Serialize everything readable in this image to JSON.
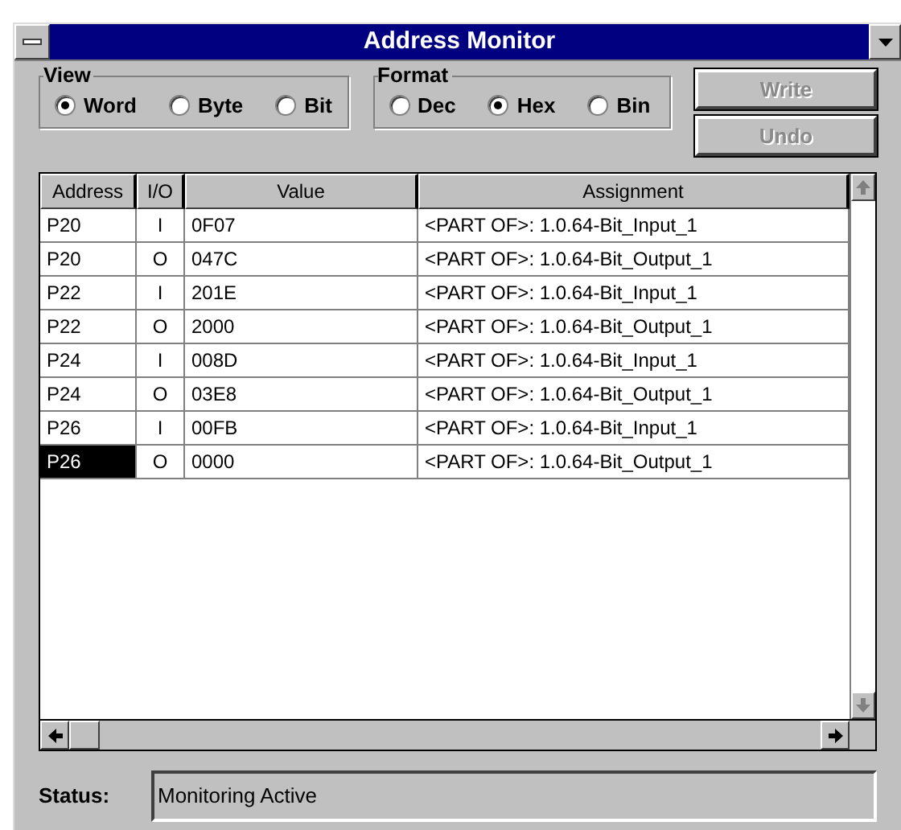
{
  "window": {
    "title": "Address Monitor"
  },
  "view": {
    "label": "View",
    "options": [
      {
        "label": "Word",
        "selected": true
      },
      {
        "label": "Byte",
        "selected": false
      },
      {
        "label": "Bit",
        "selected": false
      }
    ]
  },
  "format": {
    "label": "Format",
    "options": [
      {
        "label": "Dec",
        "selected": false
      },
      {
        "label": "Hex",
        "selected": true
      },
      {
        "label": "Bin",
        "selected": false
      }
    ]
  },
  "buttons": [
    {
      "label": "Write",
      "disabled": true
    },
    {
      "label": "Undo",
      "disabled": true
    }
  ],
  "table": {
    "columns": [
      "Address",
      "I/O",
      "Value",
      "Assignment"
    ],
    "rows": [
      {
        "address": "P20",
        "io": "I",
        "value": "0F07",
        "assignment": "<PART OF>: 1.0.64-Bit_Input_1",
        "selected": false
      },
      {
        "address": "P20",
        "io": "O",
        "value": "047C",
        "assignment": "<PART OF>: 1.0.64-Bit_Output_1",
        "selected": false
      },
      {
        "address": "P22",
        "io": "I",
        "value": "201E",
        "assignment": "<PART OF>: 1.0.64-Bit_Input_1",
        "selected": false
      },
      {
        "address": "P22",
        "io": "O",
        "value": "2000",
        "assignment": "<PART OF>: 1.0.64-Bit_Output_1",
        "selected": false
      },
      {
        "address": "P24",
        "io": "I",
        "value": "008D",
        "assignment": "<PART OF>: 1.0.64-Bit_Input_1",
        "selected": false
      },
      {
        "address": "P24",
        "io": "O",
        "value": "03E8",
        "assignment": "<PART OF>: 1.0.64-Bit_Output_1",
        "selected": false
      },
      {
        "address": "P26",
        "io": "I",
        "value": "00FB",
        "assignment": "<PART OF>: 1.0.64-Bit_Input_1",
        "selected": false
      },
      {
        "address": "P26",
        "io": "O",
        "value": "0000",
        "assignment": "<PART OF>: 1.0.64-Bit_Output_1",
        "selected": true
      }
    ]
  },
  "status": {
    "label": "Status:",
    "value": "Monitoring Active"
  }
}
